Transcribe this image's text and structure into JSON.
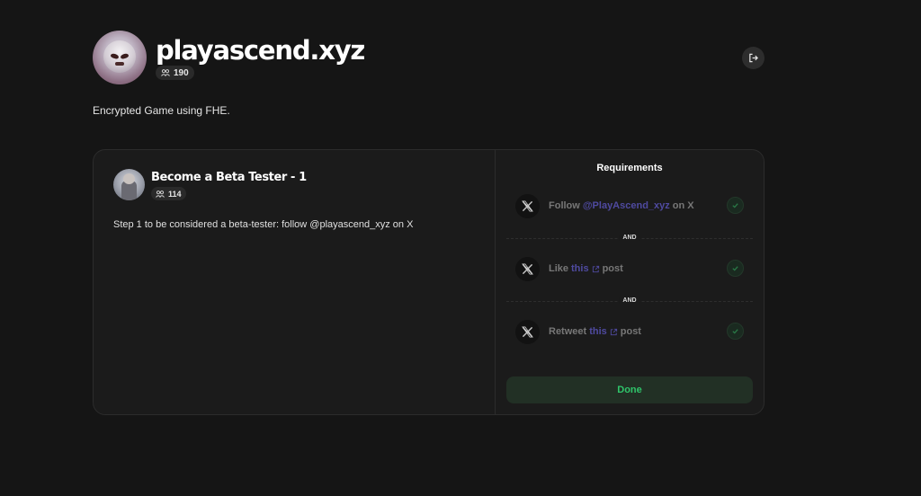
{
  "header": {
    "title": "playascend.xyz",
    "points": "190",
    "points_icon": "users-icon",
    "avatar_icon": "skull-avatar"
  },
  "description": "Encrypted Game using FHE.",
  "actions": {
    "logout_icon": "logout-icon"
  },
  "quest": {
    "title": "Become a Beta Tester - 1",
    "points": "114",
    "step_text": "Step 1 to be considered a beta-tester: follow @playascend_xyz on X"
  },
  "requirements": {
    "title": "Requirements",
    "and_label": "AND",
    "items": [
      {
        "prefix": "Follow",
        "link": "@PlayAscend_xyz",
        "suffix": "on X",
        "external": false
      },
      {
        "prefix": "Like",
        "link": "this",
        "suffix": "post",
        "external": true
      },
      {
        "prefix": "Retweet",
        "link": "this",
        "suffix": "post",
        "external": true
      }
    ],
    "done_label": "Done"
  },
  "colors": {
    "background": "#151515",
    "card": "#1b1b1b",
    "link": "#4f4aa0",
    "done_text": "#2fc46a",
    "done_bg": "#223025"
  }
}
